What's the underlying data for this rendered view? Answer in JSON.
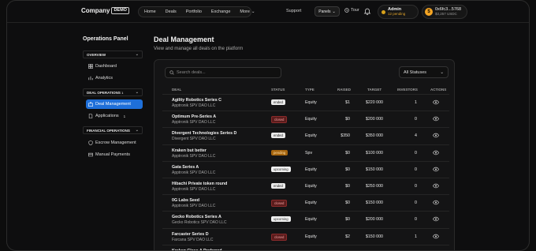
{
  "brand": {
    "name": "Company",
    "badge": "DEMO"
  },
  "nav": [
    "Home",
    "Deals",
    "Portfolio",
    "Exchange",
    "More"
  ],
  "header": {
    "support": "Support",
    "panels": "Panels",
    "tour": "Tour",
    "admin": {
      "name": "Admin",
      "pending": "12 pending"
    },
    "wallet": {
      "address": "0x6fc3...5768",
      "balance": "$3,257 USDC",
      "coin": "$"
    }
  },
  "sidebar": {
    "title": "Operations Panel",
    "sections": [
      {
        "label": "OVERVIEW",
        "count": ""
      },
      {
        "label": "DEAL OPERATIONS",
        "count": "1"
      },
      {
        "label": "FINANCIAL OPERATIONS",
        "count": ""
      }
    ],
    "items": [
      {
        "label": "Dashboard"
      },
      {
        "label": "Analytics"
      },
      {
        "label": "Deal Management"
      },
      {
        "label": "Applications",
        "count": "1"
      },
      {
        "label": "Escrow Management"
      },
      {
        "label": "Manual Payments"
      }
    ]
  },
  "main": {
    "title": "Deal Management",
    "subtitle": "View and manage all deals on the platform",
    "search_placeholder": "Search deals...",
    "status_filter": "All Statuses"
  },
  "table": {
    "columns": [
      "DEAL",
      "STATUS",
      "TYPE",
      "RAISED",
      "TARGET",
      "INVESTORS",
      "ACTIONS"
    ],
    "rows": [
      {
        "name": "Agility Robotics Series C",
        "issuer": "Apptronik SPV DAO LLC",
        "status": "ended",
        "type": "Equity",
        "raised": "$1",
        "target": "$220 000",
        "investors": "1"
      },
      {
        "name": "Optimum Pre-Series A",
        "issuer": "Apptronik SPV DAO LLC",
        "status": "closed",
        "type": "Equity",
        "raised": "$0",
        "target": "$200 000",
        "investors": "0"
      },
      {
        "name": "Divergent Technologies Series D",
        "issuer": "Divergent SPV DAO LLC",
        "status": "ended",
        "type": "Equity",
        "raised": "$350",
        "target": "$350 000",
        "investors": "4"
      },
      {
        "name": "Kraken but better",
        "issuer": "Apptronik SPV DAO LLC",
        "status": "pending",
        "type": "Spv",
        "raised": "$0",
        "target": "$100 000",
        "investors": "0"
      },
      {
        "name": "Gata Series A",
        "issuer": "Apptronik SPV DAO LLC",
        "status": "upcoming",
        "type": "Equity",
        "raised": "$0",
        "target": "$150 000",
        "investors": "0"
      },
      {
        "name": "Hibachi Private token round",
        "issuer": "Apptronik SPV DAO LLC",
        "status": "ended",
        "type": "Equity",
        "raised": "$0",
        "target": "$250 000",
        "investors": "0"
      },
      {
        "name": "0G Labs Seed",
        "issuer": "Apptronik SPV DAO LLC",
        "status": "closed",
        "type": "Equity",
        "raised": "$0",
        "target": "$150 000",
        "investors": "0"
      },
      {
        "name": "Gecko Robotics Series A",
        "issuer": "Gecko Robotics SPV DAO LLC",
        "status": "upcoming",
        "type": "Equity",
        "raised": "$0",
        "target": "$200 000",
        "investors": "0"
      },
      {
        "name": "Farcaster Series D",
        "issuer": "Farcana SPV DAO LLC",
        "status": "closed",
        "type": "Equity",
        "raised": "$2",
        "target": "$150 000",
        "investors": "1"
      },
      {
        "name": "Kraken Class A Preferred",
        "issuer": "",
        "status": "",
        "type": "",
        "raised": "",
        "target": "",
        "investors": ""
      }
    ]
  }
}
